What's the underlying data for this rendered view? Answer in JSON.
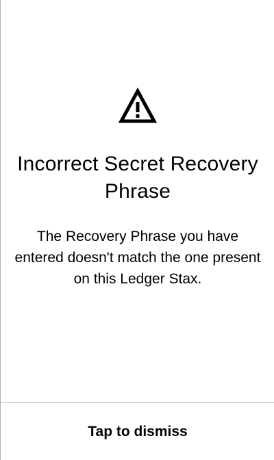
{
  "icon": "warning-triangle-icon",
  "title": "Incorrect Secret Recovery Phrase",
  "message": "The Recovery Phrase you have entered doesn't match the one present on this Ledger Stax.",
  "action": {
    "dismiss_label": "Tap to dismiss"
  },
  "colors": {
    "text": "#000000",
    "background": "#ffffff",
    "divider": "#b3b3b3"
  }
}
